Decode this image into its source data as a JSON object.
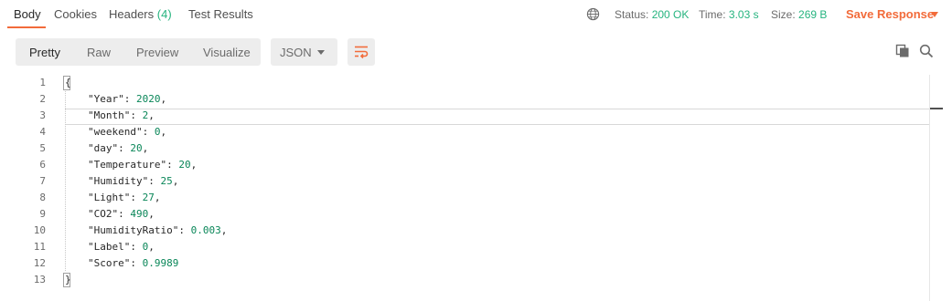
{
  "tabs": {
    "body": "Body",
    "cookies": "Cookies",
    "headers_label": "Headers",
    "headers_count": "(4)",
    "test_results": "Test Results"
  },
  "status": {
    "status_label": "Status:",
    "status_value": "200 OK",
    "time_label": "Time:",
    "time_value": "3.03 s",
    "size_label": "Size:",
    "size_value": "269 B"
  },
  "save_response": "Save Response",
  "view_modes": {
    "pretty": "Pretty",
    "raw": "Raw",
    "preview": "Preview",
    "visualize": "Visualize"
  },
  "format": "JSON",
  "icons": {
    "globe": "globe-icon",
    "wrap": "wrap-lines-icon",
    "copy": "copy-icon",
    "search": "search-icon",
    "caret": "chevron-down-icon"
  },
  "colors": {
    "accent": "#f26b3a",
    "status_ok": "#26b47f",
    "number": "#098658"
  },
  "code": {
    "line_numbers": [
      "1",
      "2",
      "3",
      "4",
      "5",
      "6",
      "7",
      "8",
      "9",
      "10",
      "11",
      "12",
      "13"
    ],
    "lines": [
      {
        "key": "",
        "value": "",
        "text": "{"
      },
      {
        "key": "\"Year\"",
        "value": "2020",
        "suffix": ","
      },
      {
        "key": "\"Month\"",
        "value": "2",
        "suffix": ","
      },
      {
        "key": "\"weekend\"",
        "value": "0",
        "suffix": ","
      },
      {
        "key": "\"day\"",
        "value": "20",
        "suffix": ","
      },
      {
        "key": "\"Temperature\"",
        "value": "20",
        "suffix": ","
      },
      {
        "key": "\"Humidity\"",
        "value": "25",
        "suffix": ","
      },
      {
        "key": "\"Light\"",
        "value": "27",
        "suffix": ","
      },
      {
        "key": "\"CO2\"",
        "value": "490",
        "suffix": ","
      },
      {
        "key": "\"HumidityRatio\"",
        "value": "0.003",
        "suffix": ","
      },
      {
        "key": "\"Label\"",
        "value": "0",
        "suffix": ","
      },
      {
        "key": "\"Score\"",
        "value": "0.9989",
        "suffix": ""
      },
      {
        "key": "",
        "value": "",
        "text": "}"
      }
    ]
  }
}
